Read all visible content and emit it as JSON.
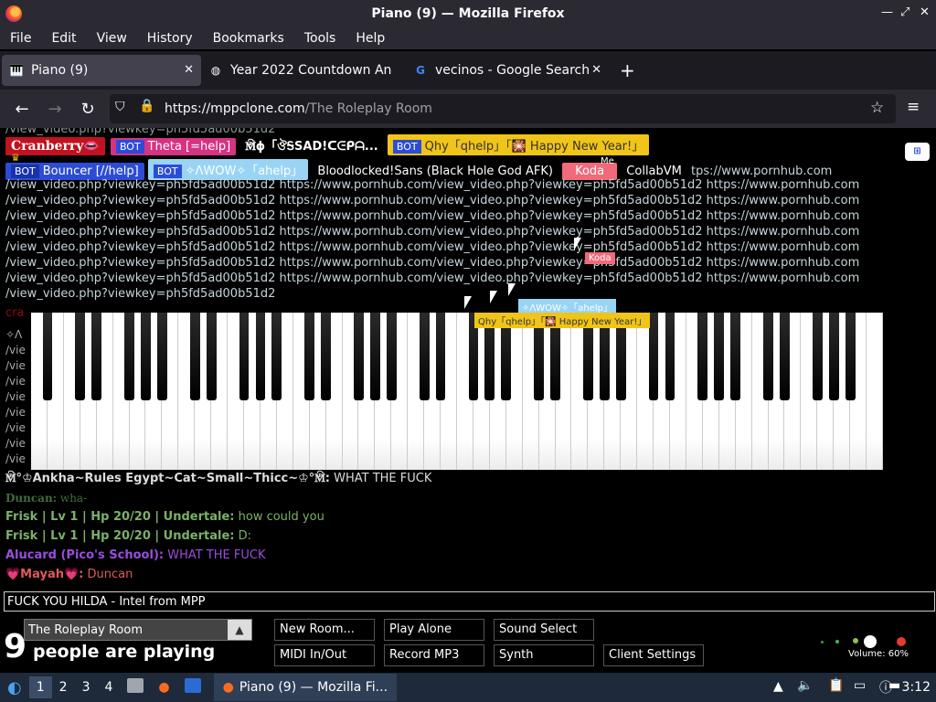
{
  "window": {
    "title": "Piano (9) — Mozilla Firefox"
  },
  "menu": [
    "File",
    "Edit",
    "View",
    "History",
    "Bookmarks",
    "Tools",
    "Help"
  ],
  "tabs": [
    {
      "label": "Piano (9)",
      "icon": "piano-icon"
    },
    {
      "label": "Year 2022 Countdown An",
      "icon": "globe-icon"
    },
    {
      "label": "vecinos - Google Search",
      "icon": "google-icon"
    }
  ],
  "url": {
    "host": "https://mppclone.com",
    "path": "/The Roleplay Room"
  },
  "users_row1": {
    "cranberry": "Cranberry",
    "theta": "Theta [=help]",
    "sad": "🕅ϕ「ঔᎦSAD!ᑕᕮᑭᗩ...",
    "qhy": "Qhy「qhelp」「🎇 Happy New Year!」"
  },
  "users_row2": {
    "bouncer": "Bouncer [//help]",
    "awow": "✧ΛWOW✧「ahelp」",
    "bloodlocked": "Bloodlocked!Sans (Black Hole God AFK)",
    "koda": "Koda",
    "collab": "CollabVM",
    "trail": "tps://www.pornhub.com"
  },
  "bot_label": "BOT",
  "me_label": "Me",
  "link_lines": [
    "/view_video.php?viewkey=ph5fd5ad00b51d2 https://www.pornhub.com/view_video.php?viewkey=ph5fd5ad00b51d2 https://www.pornhub.com",
    "/view_video.php?viewkey=ph5fd5ad00b51d2 https://www.pornhub.com/view_video.php?viewkey=ph5fd5ad00b51d2 https://www.pornhub.com",
    "/view_video.php?viewkey=ph5fd5ad00b51d2 https://www.pornhub.com/view_video.php?viewkey=ph5fd5ad00b51d2 https://www.pornhub.com",
    "/view_video.php?viewkey=ph5fd5ad00b51d2 https://www.pornhub.com/view_video.php?viewkey=ph5fd5ad00b51d2 https://www.pornhub.com",
    "/view_video.php?viewkey=ph5fd5ad00b51d2 https://www.pornhub.com/view_video.php?viewkey=ph5fd5ad00b51d2 https://www.pornhub.com",
    "/view_video.php?viewkey=ph5fd5ad00b51d2 https://www.pornhub.com/view_video.php?viewkey=ph5fd5ad00b51d2 https://www.pornhub.com",
    "/view_video.php?viewkey=ph5fd5ad00b51d2 https://www.pornhub.com/view_video.php?viewkey=ph5fd5ad00b51d2 https://www.pornhub.com",
    "/view_video.php?viewkey=ph5fd5ad00b51d2"
  ],
  "cursor_tags": {
    "koda": "Koda",
    "awow": "✧ΛWOW✧「ahelp」",
    "qhy": "Qhy「qhelp」「🎇 Happy New Year!」"
  },
  "messages": [
    {
      "name": "🕅°♔Ankha~Rules Egypt~Cat~Small~Thicc~♔°🕅:",
      "text": "WHAT THE FUCK",
      "color": "#dddddd"
    },
    {
      "name": "Duncan:",
      "text": "wha-",
      "color": "#3f6f3a"
    },
    {
      "name": "Frisk | Lv 1 | Hp 20/20 | Undertale:",
      "text": "how could you",
      "color": "#7cb06a"
    },
    {
      "name": "Frisk | Lv 1 | Hp 20/20 | Undertale:",
      "text": "D:",
      "color": "#7cb06a"
    },
    {
      "name": "Alucard (Pico's School):",
      "text": "WHAT THE FUCK",
      "color": "#9b4de0"
    },
    {
      "name": "💗Mayah💗:",
      "text": "Duncan",
      "color": "#e05a5a"
    }
  ],
  "chat_input": "FUCK YOU HILDA - Intel from MPP",
  "room": {
    "name": "The Roleplay Room",
    "count": "9",
    "count_label": "people are playing"
  },
  "buttons": {
    "new_room": "New Room...",
    "play_alone": "Play Alone",
    "sound_select": "Sound Select",
    "midi": "MIDI In/Out",
    "record": "Record MP3",
    "synth": "Synth",
    "client_settings": "Client Settings"
  },
  "volume": "Volume: 60%",
  "taskbar": {
    "workspaces": [
      "1",
      "2",
      "3",
      "4"
    ],
    "window": "Piano (9) — Mozilla Fi...",
    "clock": "3:12"
  },
  "colors": {
    "cranberry": "#c1121f",
    "theta": "#d63384",
    "qhy": "#f0c419",
    "bouncer": "#2c4cd6",
    "awow": "#9ad4f5",
    "koda": "#f06a7a"
  }
}
